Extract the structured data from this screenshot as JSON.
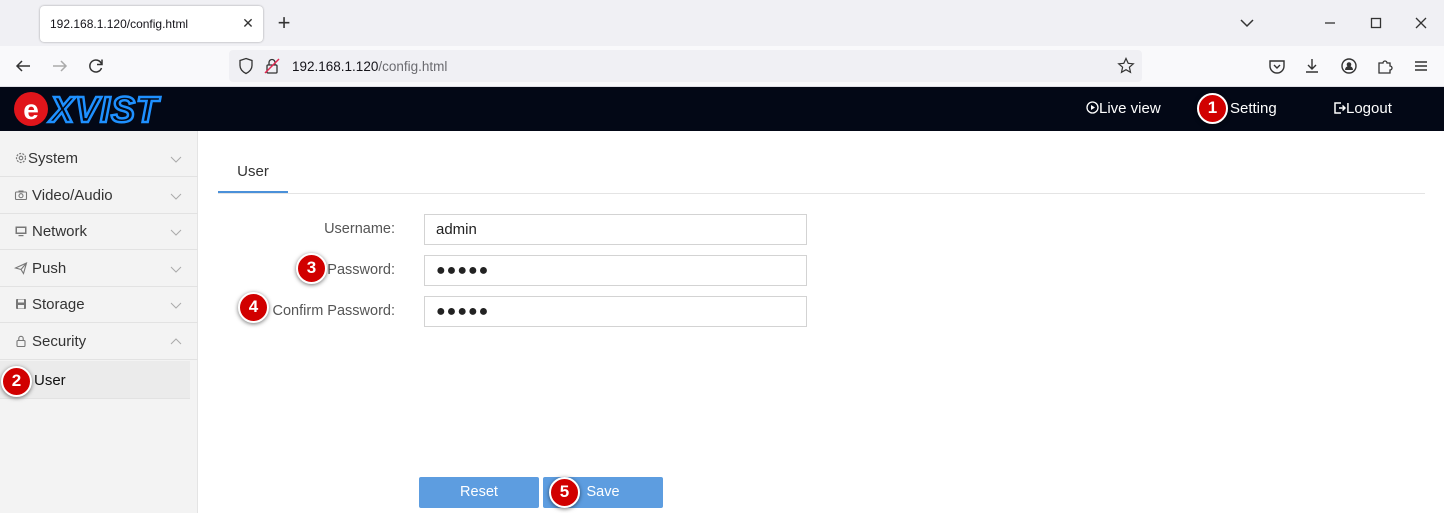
{
  "browser": {
    "tab_title": "192.168.1.120/config.html",
    "url_host": "192.168.1.120",
    "url_path": "/config.html"
  },
  "header": {
    "logo_text": "eXVIST",
    "live_view": "Live view",
    "setting": "Setting",
    "logout": "Logout",
    "background": "#030816",
    "logo_color": "#1e90ff",
    "logo_accent": "#e0151b"
  },
  "sidebar": {
    "items": [
      {
        "label": "System",
        "icon": "gear-icon"
      },
      {
        "label": "Video/Audio",
        "icon": "camera-icon"
      },
      {
        "label": "Network",
        "icon": "monitor-icon"
      },
      {
        "label": "Push",
        "icon": "send-icon"
      },
      {
        "label": "Storage",
        "icon": "floppy-icon"
      },
      {
        "label": "Security",
        "icon": "lock-icon"
      }
    ],
    "subitem": "User"
  },
  "main": {
    "tab": "User",
    "fields": {
      "username_label": "Username:",
      "username_value": "admin",
      "password_label": "Password:",
      "password_value": "●●●●●",
      "confirm_label": "Confirm Password:",
      "confirm_value": "●●●●●"
    },
    "reset_label": "Reset",
    "save_label": "Save",
    "accent": "#5d9de0"
  },
  "markers": [
    "1",
    "2",
    "3",
    "4",
    "5"
  ]
}
